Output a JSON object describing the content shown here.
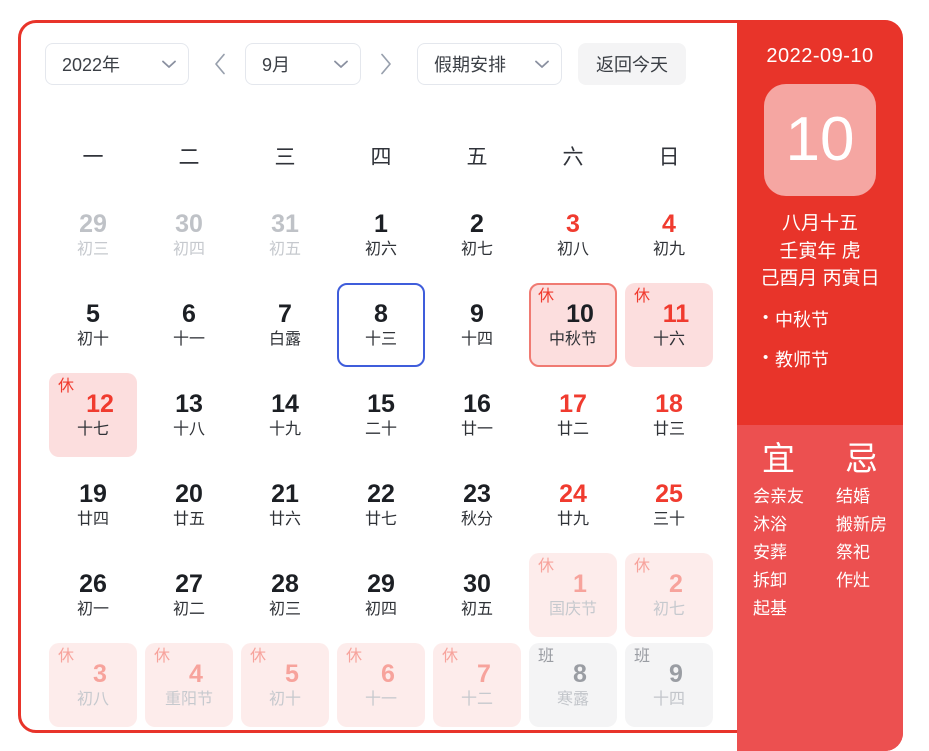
{
  "toolbar": {
    "year_value": "2022年",
    "month_value": "9月",
    "holiday_value": "假期安排",
    "today_button": "返回今天",
    "prev_icon": "chevron-left-icon",
    "next_icon": "chevron-right-icon",
    "dropdown_icon": "chevron-down-icon"
  },
  "weekdays": [
    "一",
    "二",
    "三",
    "四",
    "五",
    "六",
    "日"
  ],
  "days": [
    {
      "num": "29",
      "lunar": "初三",
      "state": "other"
    },
    {
      "num": "30",
      "lunar": "初四",
      "state": "other"
    },
    {
      "num": "31",
      "lunar": "初五",
      "state": "other"
    },
    {
      "num": "1",
      "lunar": "初六",
      "state": "normal"
    },
    {
      "num": "2",
      "lunar": "初七",
      "state": "normal"
    },
    {
      "num": "3",
      "lunar": "初八",
      "state": "weekend"
    },
    {
      "num": "4",
      "lunar": "初九",
      "state": "weekend"
    },
    {
      "num": "5",
      "lunar": "初十",
      "state": "normal"
    },
    {
      "num": "6",
      "lunar": "十一",
      "state": "normal"
    },
    {
      "num": "7",
      "lunar": "白露",
      "state": "normal"
    },
    {
      "num": "8",
      "lunar": "十三",
      "state": "today"
    },
    {
      "num": "9",
      "lunar": "十四",
      "state": "normal"
    },
    {
      "num": "10",
      "lunar": "中秋节",
      "state": "selected",
      "badge": "休"
    },
    {
      "num": "11",
      "lunar": "十六",
      "state": "rest",
      "badge": "休"
    },
    {
      "num": "12",
      "lunar": "十七",
      "state": "rest",
      "badge": "休"
    },
    {
      "num": "13",
      "lunar": "十八",
      "state": "normal"
    },
    {
      "num": "14",
      "lunar": "十九",
      "state": "normal"
    },
    {
      "num": "15",
      "lunar": "二十",
      "state": "normal"
    },
    {
      "num": "16",
      "lunar": "廿一",
      "state": "normal"
    },
    {
      "num": "17",
      "lunar": "廿二",
      "state": "weekend"
    },
    {
      "num": "18",
      "lunar": "廿三",
      "state": "weekend"
    },
    {
      "num": "19",
      "lunar": "廿四",
      "state": "normal"
    },
    {
      "num": "20",
      "lunar": "廿五",
      "state": "normal"
    },
    {
      "num": "21",
      "lunar": "廿六",
      "state": "normal"
    },
    {
      "num": "22",
      "lunar": "廿七",
      "state": "normal"
    },
    {
      "num": "23",
      "lunar": "秋分",
      "state": "normal"
    },
    {
      "num": "24",
      "lunar": "廿九",
      "state": "weekend"
    },
    {
      "num": "25",
      "lunar": "三十",
      "state": "weekend"
    },
    {
      "num": "26",
      "lunar": "初一",
      "state": "normal"
    },
    {
      "num": "27",
      "lunar": "初二",
      "state": "normal"
    },
    {
      "num": "28",
      "lunar": "初三",
      "state": "normal"
    },
    {
      "num": "29",
      "lunar": "初四",
      "state": "normal"
    },
    {
      "num": "30",
      "lunar": "初五",
      "state": "normal"
    },
    {
      "num": "1",
      "lunar": "国庆节",
      "state": "next-rest",
      "badge": "休"
    },
    {
      "num": "2",
      "lunar": "初七",
      "state": "next-rest",
      "badge": "休"
    },
    {
      "num": "3",
      "lunar": "初八",
      "state": "next-rest",
      "badge": "休"
    },
    {
      "num": "4",
      "lunar": "重阳节",
      "state": "next-rest",
      "badge": "休"
    },
    {
      "num": "5",
      "lunar": "初十",
      "state": "next-rest",
      "badge": "休"
    },
    {
      "num": "6",
      "lunar": "十一",
      "state": "next-rest",
      "badge": "休"
    },
    {
      "num": "7",
      "lunar": "十二",
      "state": "next-rest",
      "badge": "休"
    },
    {
      "num": "8",
      "lunar": "寒露",
      "state": "next-work",
      "badge": "班"
    },
    {
      "num": "9",
      "lunar": "十四",
      "state": "next-work",
      "badge": "班"
    }
  ],
  "sidebar": {
    "date": "2022-09-10",
    "day_number": "10",
    "lunar_day": "八月十五",
    "ganzhi_year": "壬寅年 虎",
    "ganzhi_month_day": "己酉月 丙寅日",
    "festivals": [
      "中秋节",
      "教师节"
    ],
    "yi": {
      "title": "宜",
      "items": [
        "会亲友",
        "沐浴",
        "安葬",
        "拆卸",
        "起基"
      ]
    },
    "ji": {
      "title": "忌",
      "items": [
        "结婚",
        "搬新房",
        "祭祀",
        "作灶"
      ]
    }
  },
  "colors": {
    "brand_red": "#e8342a",
    "light_red": "#ec5050",
    "pink_tile": "#fcdede",
    "today_blue": "#3f5ddb",
    "selected_border": "#f07a72"
  }
}
